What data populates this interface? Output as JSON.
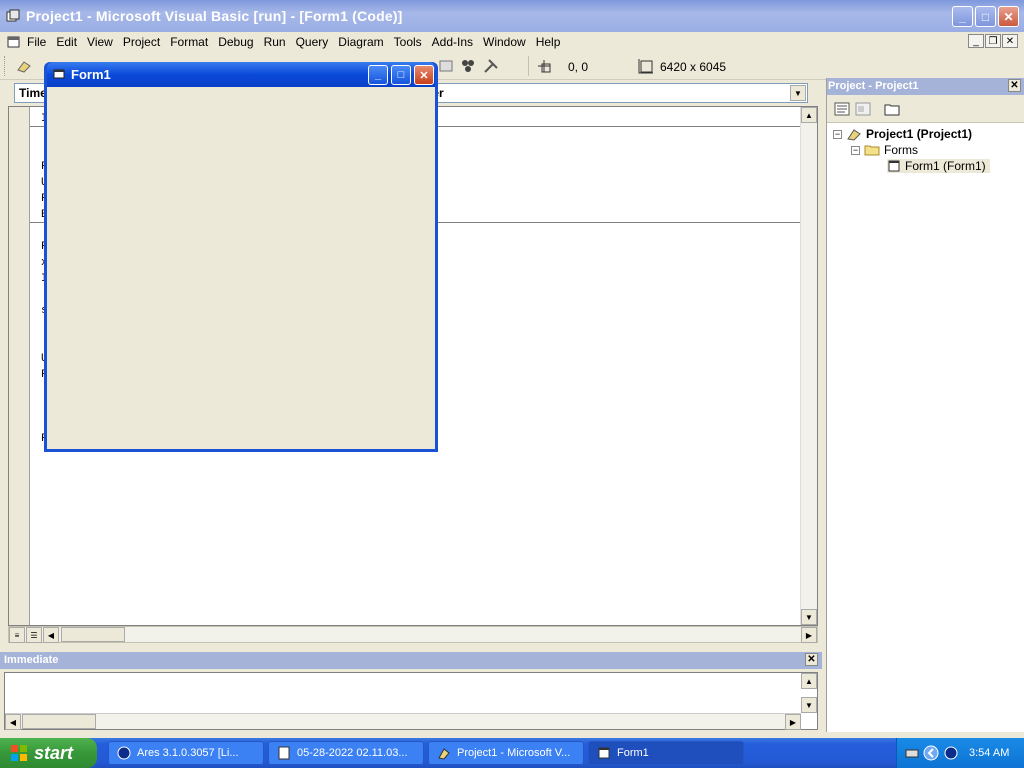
{
  "window": {
    "title": "Project1 - Microsoft Visual Basic [run] - [Form1 (Code)]",
    "min": "_",
    "max": "□",
    "close": "✕"
  },
  "menu": {
    "items": [
      "File",
      "Edit",
      "View",
      "Project",
      "Format",
      "Debug",
      "Run",
      "Query",
      "Diagram",
      "Tools",
      "Add-Ins",
      "Window",
      "Help"
    ],
    "mdi_min": "_",
    "mdi_restore": "❐",
    "mdi_close": "✕"
  },
  "toolbar": {
    "position": "0, 0",
    "size": "6420 x 6045"
  },
  "code": {
    "object_combo": "Time",
    "proc_combo": "ner",
    "visible_chars": [
      "I",
      "F",
      "U",
      "F",
      "E",
      "F",
      "x",
      "I",
      "s",
      "U",
      "F",
      "F"
    ]
  },
  "form1": {
    "title": "Form1"
  },
  "project": {
    "title": "Project - Project1",
    "close": "✕",
    "root": "Project1 (Project1)",
    "folder": "Forms",
    "item": "Form1 (Form1)"
  },
  "immediate": {
    "title": "Immediate",
    "close": "✕"
  },
  "taskbar": {
    "start": "start",
    "tasks": [
      {
        "label": "Ares 3.1.0.3057   [Li..."
      },
      {
        "label": "05-28-2022 02.11.03..."
      },
      {
        "label": "Project1 - Microsoft V..."
      },
      {
        "label": "Form1"
      }
    ],
    "clock": "3:54 AM"
  },
  "colors": {
    "title_bar": "#9aaee4",
    "form_title": "#0a4ad8",
    "taskbar": "#245edb",
    "start": "#37983a",
    "panel_header": "#a6b3d9"
  }
}
